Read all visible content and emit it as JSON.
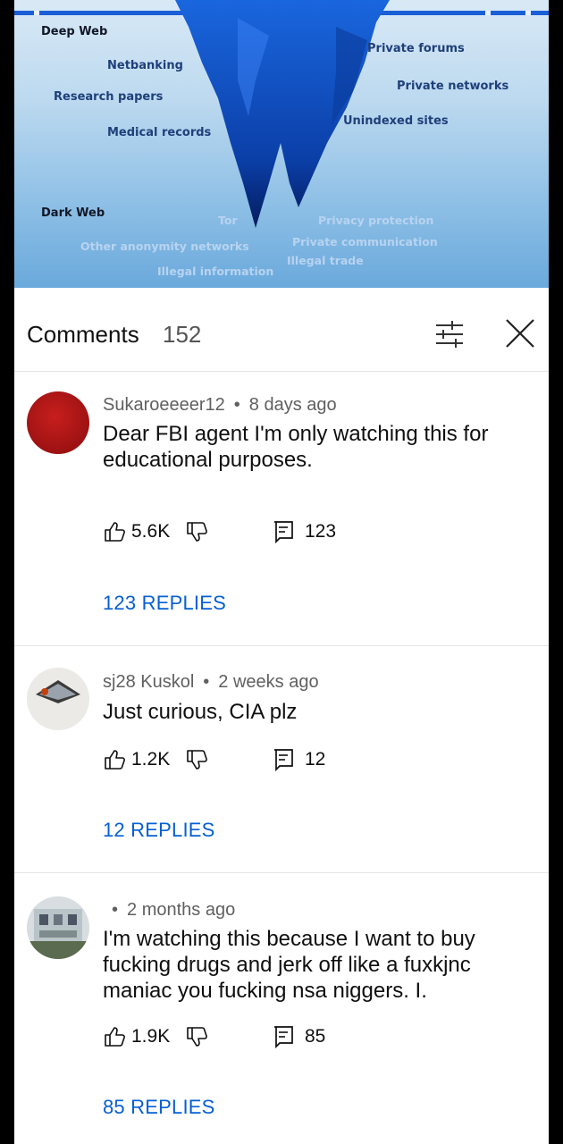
{
  "video": {
    "labels": {
      "deep_web": "Deep Web",
      "netbanking": "Netbanking",
      "research_papers": "Research papers",
      "medical_records": "Medical records",
      "private_forums": "Private forums",
      "private_networks": "Private networks",
      "unindexed_sites": "Unindexed sites",
      "dark_web": "Dark Web",
      "tor": "Tor",
      "privacy_protection": "Privacy protection",
      "other_anonymity": "Other anonymity networks",
      "private_communication": "Private communication",
      "illegal_trade": "Illegal trade",
      "illegal_information": "Illegal information"
    },
    "colors": {
      "ice": "#1a5fd6",
      "ice_dark": "#06236e",
      "sky": "#bcd9ef"
    }
  },
  "header": {
    "title": "Comments",
    "count": "152",
    "filter_icon": "filter-sliders-icon",
    "close_icon": "close-icon"
  },
  "comments": [
    {
      "author": "Sukaroeeeer12",
      "time": "8 days ago",
      "text": "Dear FBI agent I'm only watching this for educational purposes.",
      "likes": "5.6K",
      "replies_count": "123",
      "replies_label": "123 REPLIES",
      "avatar_color": "#b91c1c"
    },
    {
      "author": "sj28 Kuskol",
      "time": "2 weeks ago",
      "text": "Just curious, CIA plz",
      "likes": "1.2K",
      "replies_count": "12",
      "replies_label": "12 REPLIES"
    },
    {
      "author": "",
      "time": "2 months ago",
      "text": "I'm watching this because I want to buy fucking drugs and jerk off like a fuxkjnc maniac you fucking nsa niggers. I.",
      "likes": "1.9K",
      "replies_count": "85",
      "replies_label": "85 REPLIES"
    }
  ]
}
